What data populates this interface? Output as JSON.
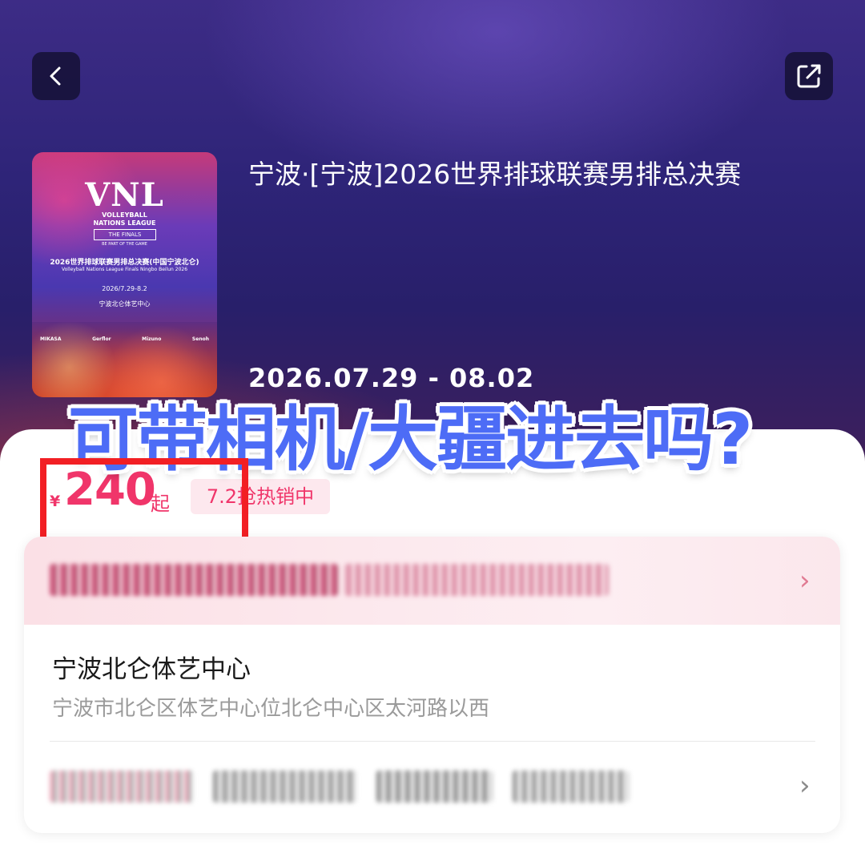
{
  "nav": {
    "back_icon": "chevron-left-icon",
    "share_icon": "share-icon"
  },
  "poster": {
    "logo": "VNL",
    "league_line1": "VOLLEYBALL",
    "league_line2": "NATIONS LEAGUE",
    "finals": "THE FINALS",
    "tagline": "BE PART OF THE GAME",
    "cn_title": "2026世界排球联赛男排总决赛(中国宁波北仑)",
    "en_title": "Volleyball Nations League Finals Ningbo Beilun 2026",
    "date": "2026/7.29-8.2",
    "venue": "宁波北仑体艺中心",
    "sponsors": [
      "MIKASA",
      "Gerflor",
      "Mizuno",
      "Senoh"
    ]
  },
  "event": {
    "title": "宁波·[宁波]2026世界排球联赛男排总决赛",
    "date": "2026.07.29 - 08.02"
  },
  "overlay_text": "可带相机/大疆进去吗?",
  "price": {
    "currency": "¥",
    "amount": "240",
    "suffix": "起",
    "badge": "7.2抢热销中"
  },
  "venue": {
    "name": "宁波北仑体艺中心",
    "address": "宁波市北仑区体艺中心位北仑中心区太河路以西"
  },
  "colors": {
    "accent": "#f0356a",
    "overlay": "#4d6cf6",
    "highlight": "#f21f24"
  }
}
